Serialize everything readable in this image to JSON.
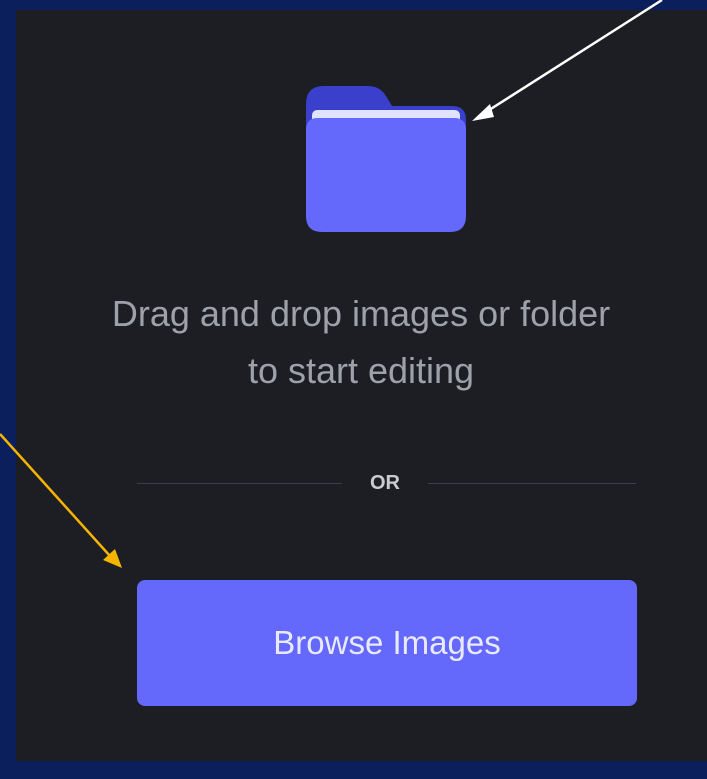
{
  "upload_panel": {
    "icon": "folder-icon",
    "instruction": "Drag and drop images or folder to start editing",
    "divider_label": "OR",
    "browse_button_label": "Browse Images"
  },
  "colors": {
    "panel_background": "#1c1e24",
    "accent": "#6468fb",
    "folder_back": "#3a3fcc",
    "folder_front": "#6468fb",
    "folder_paper": "#dfe3ff",
    "outer_background": "#0b1f5c",
    "annotation_arrow_white": "#ffffff",
    "annotation_arrow_yellow": "#f4b400"
  }
}
